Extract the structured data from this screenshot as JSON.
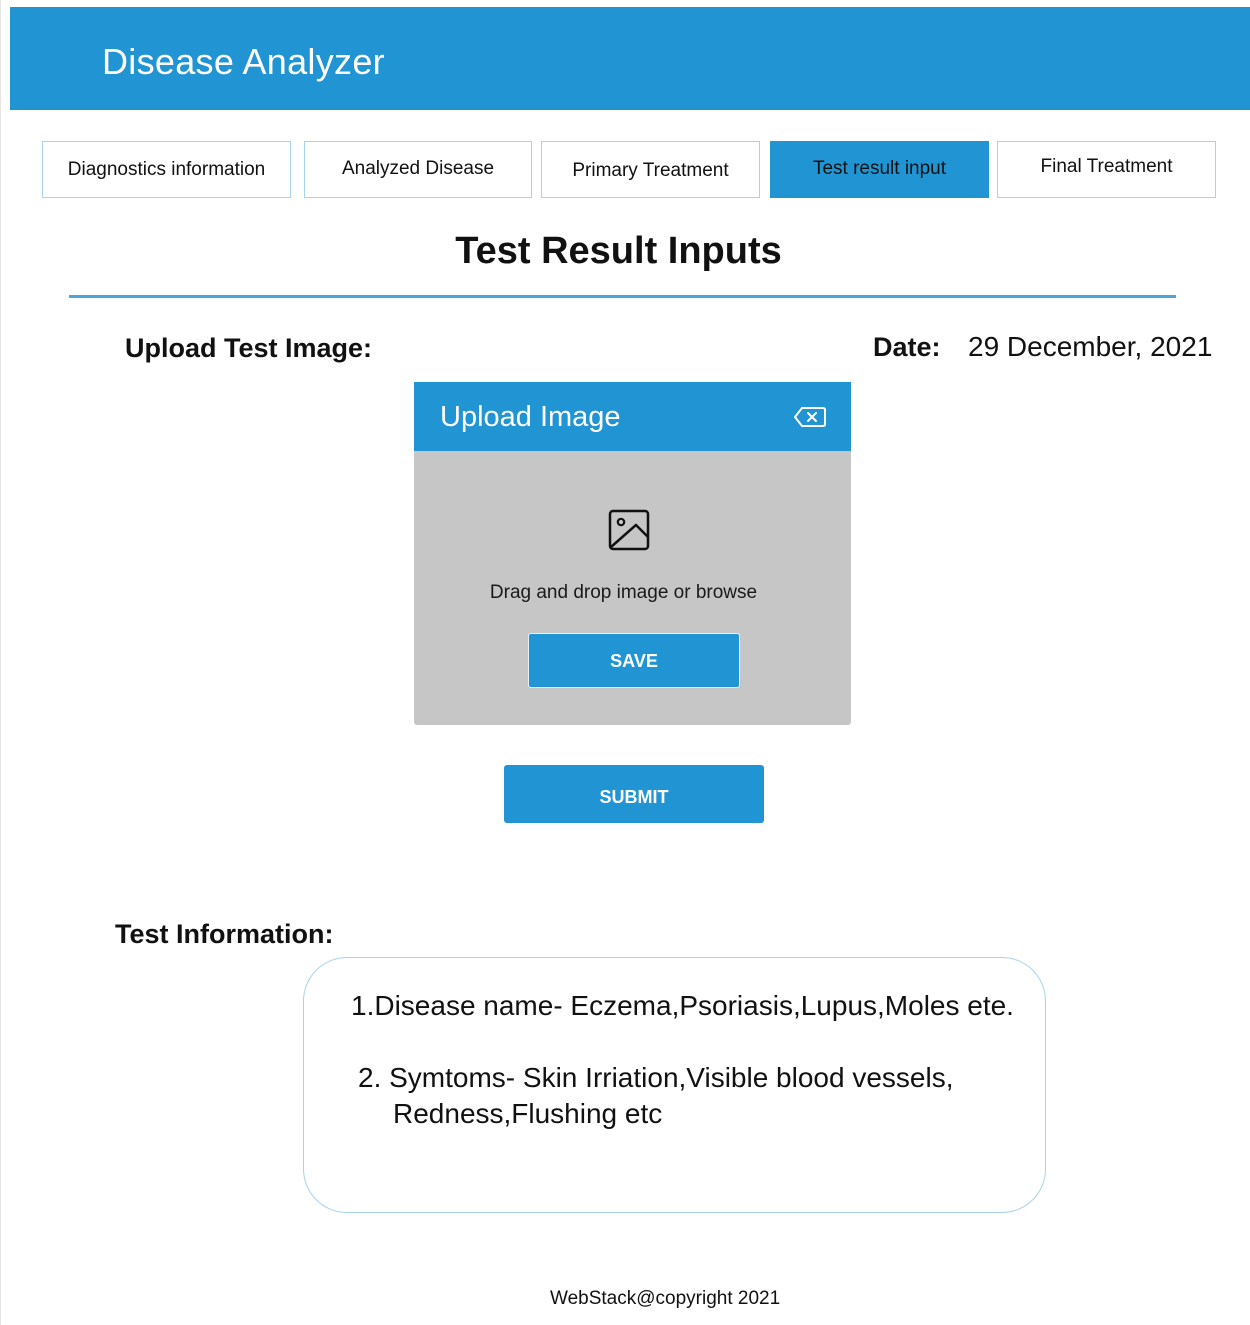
{
  "header": {
    "app_title": "Disease Analyzer",
    "color": "#2194d3"
  },
  "tabs": [
    {
      "label": "Diagnostics information",
      "active": false
    },
    {
      "label": "Analyzed Disease",
      "active": false
    },
    {
      "label": "Primary Treatment",
      "active": false
    },
    {
      "label": "Test result input",
      "active": true
    },
    {
      "label": "Final Treatment",
      "active": false
    }
  ],
  "main": {
    "title": "Test Result Inputs",
    "upload_label": "Upload Test Image:",
    "date_label": "Date:",
    "date_value": "29 December, 2021"
  },
  "upload_dialog": {
    "title": "Upload Image",
    "close_icon": "backspace-close-icon",
    "image_icon": "image-icon",
    "drop_text": "Drag and drop image or  browse",
    "save_label": "SAVE",
    "body_color": "#c6c6c6"
  },
  "submit_label": "SUBMIT",
  "test_information": {
    "label": "Test Information:",
    "line_1": "1.Disease name- Eczema,Psoriasis,Lupus,Moles ete.",
    "line_2a": "2. Symtoms- Skin Irriation,Visible blood vessels,",
    "line_2b": "Redness,Flushing etc"
  },
  "footer": {
    "text": "WebStack@copyright 2021"
  }
}
